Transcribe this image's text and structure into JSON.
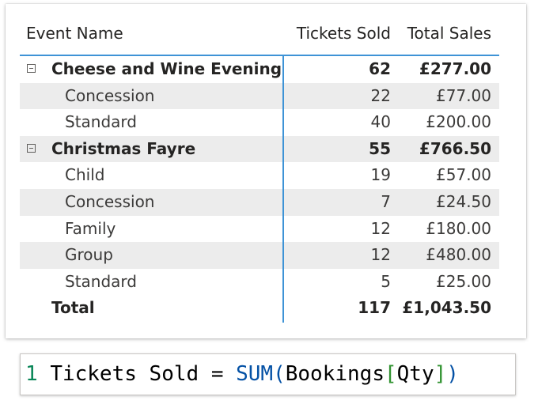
{
  "matrix": {
    "headers": {
      "name": "Event Name",
      "tickets": "Tickets Sold",
      "sales": "Total Sales"
    },
    "rows": [
      {
        "name": "Cheese and Wine Evening",
        "tickets": "62",
        "sales": "£277.00"
      },
      {
        "name": "Concession",
        "tickets": "22",
        "sales": "£77.00"
      },
      {
        "name": "Standard",
        "tickets": "40",
        "sales": "£200.00"
      },
      {
        "name": "Christmas Fayre",
        "tickets": "55",
        "sales": "£766.50"
      },
      {
        "name": "Child",
        "tickets": "19",
        "sales": "£57.00"
      },
      {
        "name": "Concession",
        "tickets": "7",
        "sales": "£24.50"
      },
      {
        "name": "Family",
        "tickets": "12",
        "sales": "£180.00"
      },
      {
        "name": "Group",
        "tickets": "12",
        "sales": "£480.00"
      },
      {
        "name": "Standard",
        "tickets": "5",
        "sales": "£25.00"
      }
    ],
    "total": {
      "name": "Total",
      "tickets": "117",
      "sales": "£1,043.50"
    },
    "colors": {
      "accent": "#3e93d6",
      "shade": "#ececec"
    }
  },
  "formula": {
    "line_number": "1",
    "measure": "Tickets Sold",
    "equals": "=",
    "function": "SUM",
    "open_paren": "(",
    "table": "Bookings",
    "open_bracket": "[",
    "column": "Qty",
    "close_bracket": "]",
    "close_paren": ")"
  }
}
